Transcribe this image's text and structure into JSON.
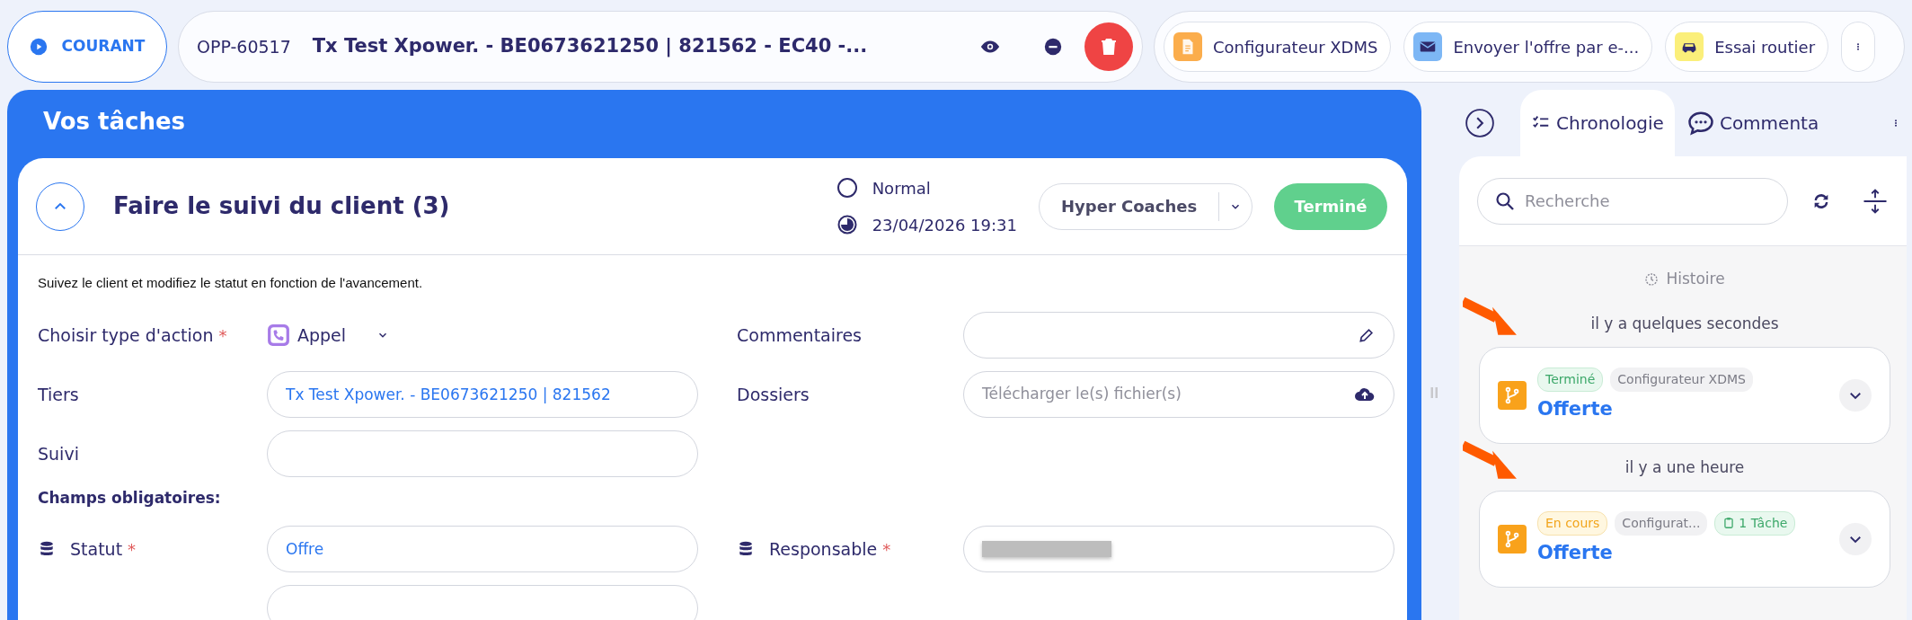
{
  "top_bar": {
    "status_button": {
      "label": "COURANT"
    },
    "record": {
      "id": "OPP-60517",
      "title": "Tx Test Xpower. - BE0673621250 | 821562 - EC40 -..."
    },
    "actions": [
      {
        "label": "Configurateur XDMS",
        "kind": "document",
        "color": "#fbad4c"
      },
      {
        "label": "Envoyer l'offre par e-...",
        "kind": "mail",
        "color": "#7db7f5"
      },
      {
        "label": "Essai routier",
        "kind": "car",
        "color": "#fbef7a"
      }
    ]
  },
  "tasks_panel": {
    "title": "Vos tâches",
    "task": {
      "title": "Faire le suivi du client (3)",
      "expanded": true,
      "priority": "Normal",
      "due": "23/04/2026 19:31",
      "assignee": "Hyper Coaches",
      "done_button": "Terminé",
      "description": "Suivez le client et modifiez le statut en fonction de l'avancement.",
      "rows": [
        {
          "left": {
            "label": "Choisir type d'action",
            "asterisk": "*",
            "linked": false,
            "kind": "select",
            "value": "Appel"
          },
          "right": {
            "label": "Commentaires",
            "linked": false,
            "kind": "edit"
          }
        },
        {
          "left": {
            "label": "Tiers",
            "linked": false,
            "kind": "text",
            "value": "Tx Test Xpower. - BE0673621250 | 821562"
          },
          "right": {
            "label": "Dossiers",
            "linked": false,
            "kind": "upload",
            "placeholder": "Télécharger le(s) fichier(s)"
          }
        },
        {
          "left": {
            "label": "Suivi",
            "linked": false,
            "kind": "text"
          }
        }
      ],
      "required_section": {
        "title": "Champs obligatoires:",
        "rows": [
          {
            "left": {
              "label": "Statut",
              "asterisk": "*",
              "linked": true,
              "kind": "text",
              "value": "Offre"
            },
            "right": {
              "label": "Responsable",
              "asterisk": "*",
              "linked": true,
              "kind": "redacted"
            }
          },
          {
            "left": {
              "kind": "text"
            }
          }
        ]
      }
    }
  },
  "timeline_panel": {
    "tabs": [
      {
        "label": "Chronologie",
        "kind": "timeline",
        "selected": true
      },
      {
        "label": "Commenta",
        "kind": "comments",
        "selected": false
      }
    ],
    "search": {
      "placeholder": "Recherche"
    },
    "section_title": "Histoire",
    "groups": [
      {
        "time": "il y a quelques secondes",
        "entries": [
          {
            "annotated": true,
            "title": "Offerte",
            "badges": [
              {
                "label": "Terminé",
                "kind": "done"
              },
              {
                "label": "Configurateur XDMS",
                "kind": "neutral"
              }
            ]
          }
        ]
      },
      {
        "time": "il y a une heure",
        "entries": [
          {
            "annotated": true,
            "title": "Offerte",
            "badges": [
              {
                "label": "En cours",
                "kind": "progress"
              },
              {
                "label": "Configurat...",
                "kind": "neutral"
              },
              {
                "label": "1 Tâche",
                "kind": "task"
              }
            ]
          }
        ]
      }
    ]
  }
}
